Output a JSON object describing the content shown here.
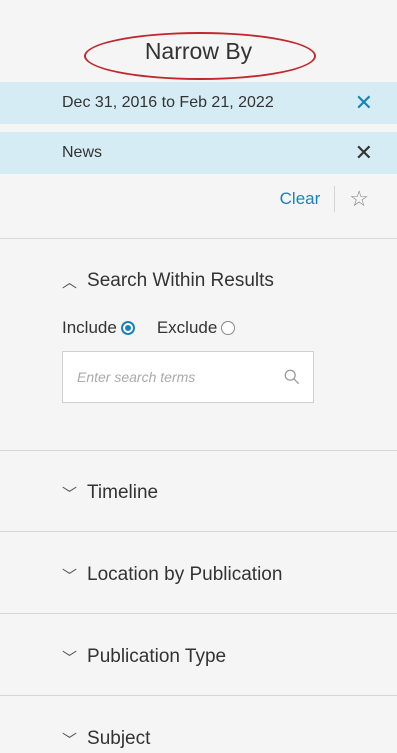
{
  "panel": {
    "title": "Narrow By",
    "highlight_color": "#c0282d",
    "accent_color": "#1a82b8",
    "chip_bg": "#d6ecf5"
  },
  "filters": [
    {
      "label": "Dec 31, 2016 to Feb 21, 2022",
      "remove_icon": "close-icon"
    },
    {
      "label": "News",
      "remove_icon": "close-icon"
    }
  ],
  "actions": {
    "clear_label": "Clear",
    "save_icon": "star-icon"
  },
  "search_within": {
    "heading": "Search Within Results",
    "expanded": true,
    "include_label": "Include",
    "exclude_label": "Exclude",
    "selected": "Include",
    "placeholder": "Enter search terms",
    "value": ""
  },
  "sections": [
    {
      "label": "Timeline",
      "expanded": false
    },
    {
      "label": "Location by Publication",
      "expanded": false
    },
    {
      "label": "Publication Type",
      "expanded": false
    },
    {
      "label": "Subject",
      "expanded": false
    }
  ]
}
